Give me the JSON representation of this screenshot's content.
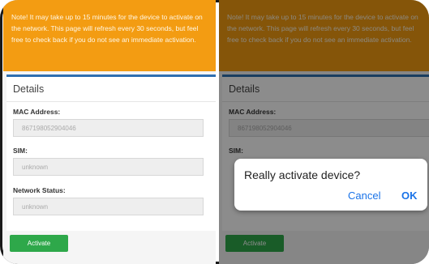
{
  "notice": {
    "text": "Note! It may take up to 15 minutes for the device to activate on the network. This page will refresh every 30 seconds, but feel free to check back if you do not see an immediate activation."
  },
  "details": {
    "title": "Details",
    "mac_label": "MAC Address:",
    "mac_value": "867198052904046",
    "sim_label": "SIM:",
    "sim_value": "unknown",
    "network_label": "Network Status:",
    "network_value": "unknown"
  },
  "activate_button": {
    "label": "Activate"
  },
  "dialog": {
    "message": "Really activate device?",
    "cancel_label": "Cancel",
    "ok_label": "OK"
  },
  "colors": {
    "notice_bg": "#f39c12",
    "card_accent": "#2f6fb0",
    "button_bg": "#2ea84a",
    "dialog_link": "#1a73e8"
  }
}
